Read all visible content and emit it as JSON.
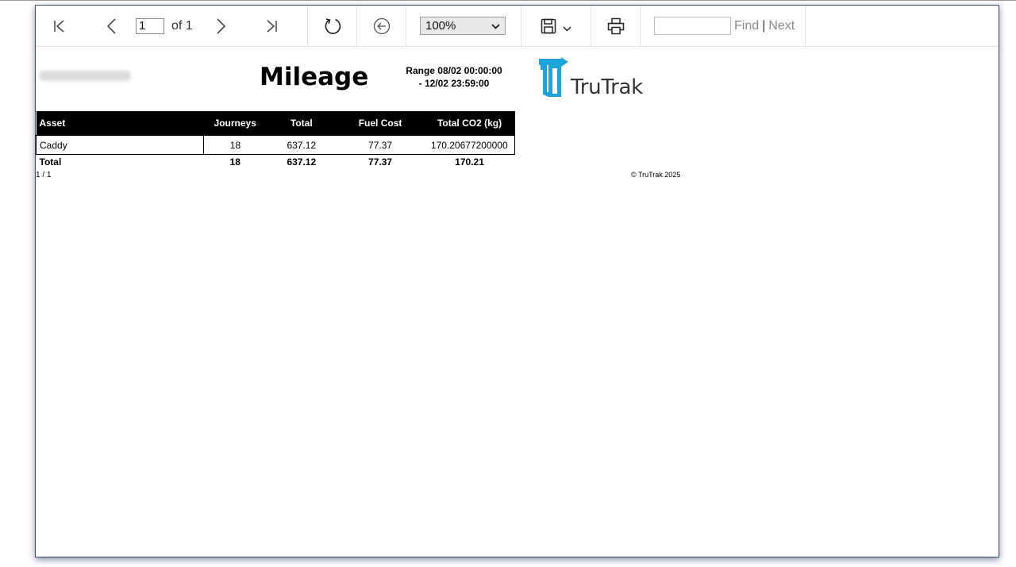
{
  "toolbar": {
    "page_current": "1",
    "page_of": "of 1",
    "zoom": "100%",
    "zoom_options": [
      "100%"
    ],
    "find_value": "",
    "find_label": "Find",
    "find_separator": "|",
    "next_label": "Next",
    "icons": {
      "first": "first-page-icon",
      "prev": "previous-page-icon",
      "next": "next-page-icon",
      "last": "last-page-icon",
      "refresh": "refresh-icon",
      "back": "back-arrow-icon",
      "save": "save-icon",
      "save_dropdown": "chevron-down-icon",
      "print": "print-icon"
    }
  },
  "report": {
    "title": "Mileage",
    "range_line1": "Range 08/02 00:00:00",
    "range_line2": "- 12/02 23:59:00",
    "logo_text": "TruTrak",
    "table": {
      "headers": [
        "Asset",
        "Journeys",
        "Total",
        "Fuel Cost",
        "Total CO2 (kg)"
      ],
      "rows": [
        [
          "Caddy",
          "18",
          "637.12",
          "77.37",
          "170.20677200000"
        ]
      ],
      "totals": [
        "Total",
        "18",
        "637.12",
        "77.37",
        "170.21"
      ]
    },
    "page_count": "1 / 1",
    "copyright": "© TruTrak 2025"
  },
  "colors": {
    "logo_blue": "#1fa3dc",
    "header_bg": "#000000",
    "frame_border": "#3c4a63"
  }
}
